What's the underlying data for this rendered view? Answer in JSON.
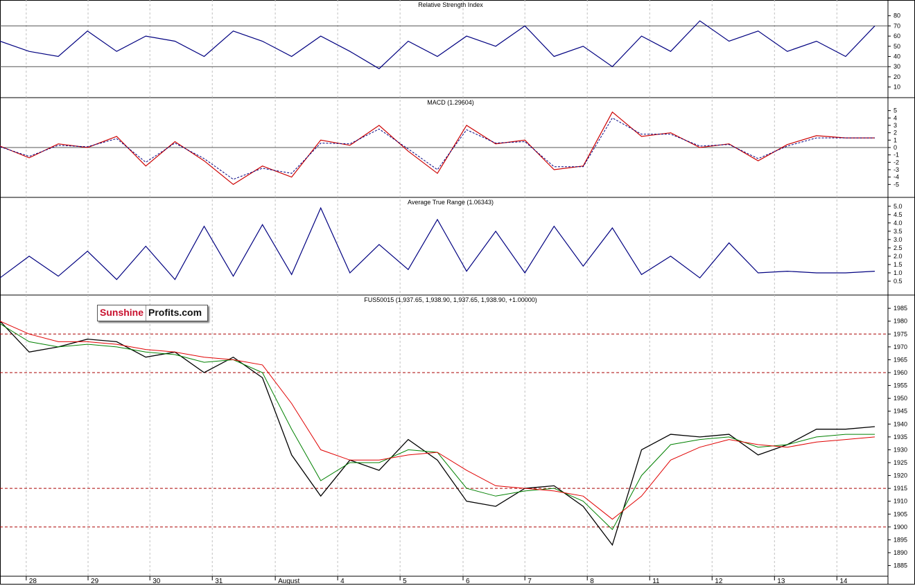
{
  "colors": {
    "background": "#ffffff",
    "grid": "#c0c0c0",
    "frame": "#000000",
    "rsi_line": "#000080",
    "macd_line": "#cc0000",
    "macd_signal": "#000080",
    "atr_line": "#000080",
    "price_line": "#000000",
    "ma_fast": "#008000",
    "ma_slow": "#e00000",
    "support_lines": "#aa0000",
    "logo_red": "#c8102e"
  },
  "logo": {
    "part1": "Sunshine",
    "part2": "Profits.com"
  },
  "chart_data": [
    {
      "type": "line",
      "title": "Relative Strength Index",
      "ylim": [
        5,
        90
      ],
      "yticks": [
        80,
        70,
        60,
        50,
        40,
        30,
        20,
        10
      ],
      "reference_lines": [
        70,
        30
      ],
      "x": [
        0,
        5,
        10,
        15,
        20,
        25,
        30,
        35,
        40,
        45,
        50,
        55,
        60,
        65,
        70,
        75,
        80,
        85,
        90,
        95,
        100,
        105,
        110,
        115,
        120,
        125,
        130,
        135,
        140,
        145,
        150
      ],
      "series": [
        {
          "values": [
            55,
            45,
            40,
            65,
            45,
            60,
            55,
            40,
            65,
            55,
            40,
            60,
            45,
            28,
            55,
            40,
            60,
            50,
            70,
            40,
            50,
            30,
            60,
            45,
            75,
            55,
            65,
            45,
            55,
            40,
            70
          ]
        }
      ],
      "grid": true
    },
    {
      "type": "line",
      "title": "MACD (1.29604)",
      "ylim": [
        -6,
        6
      ],
      "yticks": [
        5,
        4,
        3,
        2,
        1,
        0,
        -1,
        -2,
        -3,
        -4,
        -5
      ],
      "reference_lines": [
        0
      ],
      "x": [
        0,
        5,
        10,
        15,
        20,
        25,
        30,
        35,
        40,
        45,
        50,
        55,
        60,
        65,
        70,
        75,
        80,
        85,
        90,
        95,
        100,
        105,
        110,
        115,
        120,
        125,
        130,
        135,
        140,
        145,
        150
      ],
      "series": [
        {
          "values": [
            0.2,
            -1.4,
            0.5,
            0,
            1.5,
            -2.5,
            0.8,
            -1.8,
            -5,
            -2.5,
            -4,
            1,
            0.3,
            3,
            -0.5,
            -3.5,
            3,
            0.5,
            1,
            -3,
            -2.5,
            4.8,
            1.5,
            2,
            0,
            0.5,
            -1.8,
            0.4,
            1.6,
            1.3,
            1.3
          ]
        },
        {
          "values": [
            0.1,
            -1.2,
            0.3,
            0.1,
            1.2,
            -2,
            0.6,
            -1.5,
            -4.3,
            -2.8,
            -3.5,
            0.6,
            0.5,
            2.5,
            -0.2,
            -3,
            2.4,
            0.6,
            0.8,
            -2.6,
            -2.6,
            4,
            1.8,
            1.8,
            0.2,
            0.4,
            -1.5,
            0.2,
            1.3,
            1.3,
            1.3
          ]
        }
      ],
      "grid": true
    },
    {
      "type": "line",
      "title": "Average True Range (1.06343)",
      "ylim": [
        0,
        5.2
      ],
      "yticks": [
        5.0,
        4.5,
        4.0,
        3.5,
        3.0,
        2.5,
        2.0,
        1.5,
        1.0,
        0.5
      ],
      "x": [
        0,
        5,
        10,
        15,
        20,
        25,
        30,
        35,
        40,
        45,
        50,
        55,
        60,
        65,
        70,
        75,
        80,
        85,
        90,
        95,
        100,
        105,
        110,
        115,
        120,
        125,
        130,
        135,
        140,
        145,
        150
      ],
      "series": [
        {
          "values": [
            0.7,
            2.0,
            0.8,
            2.3,
            0.6,
            2.6,
            0.6,
            3.8,
            0.8,
            3.9,
            0.9,
            4.9,
            1.0,
            2.7,
            1.2,
            4.2,
            1.1,
            3.5,
            1.0,
            3.8,
            1.4,
            3.7,
            0.9,
            2.0,
            0.7,
            2.8,
            1.0,
            1.1,
            1.0,
            1.0,
            1.1
          ]
        }
      ],
      "grid": true
    },
    {
      "type": "line",
      "title": "FUS50015 (1,937.65, 1,938.90, 1,937.65, 1,938.90, +1.00000)",
      "ylim": [
        1883,
        1988
      ],
      "yticks": [
        1985,
        1980,
        1975,
        1970,
        1965,
        1960,
        1955,
        1950,
        1945,
        1940,
        1935,
        1930,
        1925,
        1920,
        1915,
        1910,
        1905,
        1900,
        1895,
        1890,
        1885
      ],
      "support_resistance": [
        1975,
        1960,
        1915,
        1900
      ],
      "x": [
        0,
        5,
        10,
        15,
        20,
        25,
        30,
        35,
        40,
        45,
        50,
        55,
        60,
        65,
        70,
        75,
        80,
        85,
        90,
        95,
        100,
        105,
        110,
        115,
        120,
        125,
        130,
        135,
        140,
        145,
        150
      ],
      "series": [
        {
          "values": [
            1980,
            1968,
            1970,
            1973,
            1972,
            1966,
            1968,
            1960,
            1966,
            1958,
            1928,
            1912,
            1926,
            1922,
            1934,
            1926,
            1910,
            1908,
            1915,
            1916,
            1908,
            1893,
            1930,
            1936,
            1935,
            1936,
            1928,
            1932,
            1938,
            1938,
            1939
          ]
        },
        {
          "values": [
            1979,
            1972,
            1970,
            1971,
            1970,
            1968,
            1967,
            1964,
            1965,
            1960,
            1938,
            1918,
            1925,
            1925,
            1930,
            1929,
            1915,
            1912,
            1914,
            1915,
            1910,
            1899,
            1920,
            1932,
            1934,
            1935,
            1931,
            1932,
            1935,
            1936,
            1936
          ]
        },
        {
          "values": [
            1980,
            1975,
            1972,
            1972,
            1971,
            1969,
            1968,
            1966,
            1965,
            1963,
            1948,
            1930,
            1926,
            1926,
            1928,
            1929,
            1922,
            1916,
            1915,
            1914,
            1912,
            1903,
            1912,
            1926,
            1931,
            1934,
            1932,
            1931,
            1933,
            1934,
            1935
          ]
        }
      ],
      "grid": true
    }
  ],
  "x_axis": {
    "labels": [
      "28",
      "29",
      "30",
      "31",
      "August",
      "4",
      "5",
      "6",
      "7",
      "8",
      "11",
      "12",
      "13",
      "14"
    ],
    "positions": [
      2.25,
      7.55,
      12.85,
      18.2,
      23.6,
      28.95,
      34.3,
      39.7,
      45.0,
      50.35,
      55.7,
      61.05,
      66.4,
      71.75
    ]
  }
}
